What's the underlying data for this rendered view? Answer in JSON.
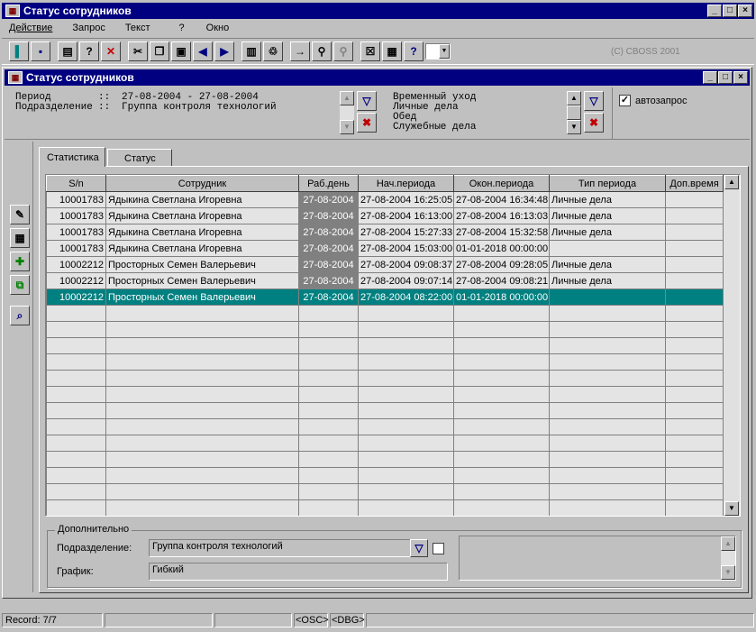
{
  "app": {
    "title": "Статус сотрудников",
    "copyright": "(C) CBOSS 2001"
  },
  "menu": [
    "Действие",
    "Запрос",
    "Текст",
    "?",
    "Окно"
  ],
  "inner_window": {
    "title": "Статус сотрудников"
  },
  "filter": {
    "period_label": "Период",
    "period_value": "27-08-2004 - 27-08-2004",
    "division_label": "Подразделение",
    "division_value": "Группа контроля технологий",
    "types": [
      "Временный уход",
      "Личные дела",
      "Обед",
      "Служебные дела"
    ],
    "autorequest_label": "автозапрос",
    "autorequest_checked": true
  },
  "tabs": [
    {
      "label": "Статистика",
      "active": true
    },
    {
      "label": "Статус",
      "active": false
    }
  ],
  "table": {
    "columns": [
      "S/n",
      "Сотрудник",
      "Раб.день",
      "Нач.периода",
      "Окон.периода",
      "Тип периода",
      "Доп.время"
    ],
    "rows": [
      [
        "10001783",
        "Ядыкина Светлана Игоревна",
        "27-08-2004",
        "27-08-2004 16:25:05",
        "27-08-2004 16:34:48",
        "Личные дела",
        ""
      ],
      [
        "10001783",
        "Ядыкина Светлана Игоревна",
        "27-08-2004",
        "27-08-2004 16:13:00",
        "27-08-2004 16:13:03",
        "Личные дела",
        ""
      ],
      [
        "10001783",
        "Ядыкина Светлана Игоревна",
        "27-08-2004",
        "27-08-2004 15:27:33",
        "27-08-2004 15:32:58",
        "Личные дела",
        ""
      ],
      [
        "10001783",
        "Ядыкина Светлана Игоревна",
        "27-08-2004",
        "27-08-2004 15:03:00",
        "01-01-2018 00:00:00",
        "",
        ""
      ],
      [
        "10002212",
        "Просторных Семен Валерьевич",
        "27-08-2004",
        "27-08-2004 09:08:37",
        "27-08-2004 09:28:05",
        "Личные дела",
        ""
      ],
      [
        "10002212",
        "Просторных Семен Валерьевич",
        "27-08-2004",
        "27-08-2004 09:07:14",
        "27-08-2004 09:08:21",
        "Личные дела",
        ""
      ],
      [
        "10002212",
        "Просторных Семен Валерьевич",
        "27-08-2004",
        "27-08-2004 08:22:00",
        "01-01-2018 00:00:00",
        "",
        ""
      ]
    ],
    "selected_row": 6,
    "empty_rows": 13
  },
  "additional": {
    "group_label": "Дополнительно",
    "division_label": "Подразделение:",
    "division_value": "Группа контроля технологий",
    "schedule_label": "График:",
    "schedule_value": "Гибкий"
  },
  "status": {
    "record": "Record: 7/7",
    "osc": "<OSC>",
    "dbg": "<DBG>"
  }
}
